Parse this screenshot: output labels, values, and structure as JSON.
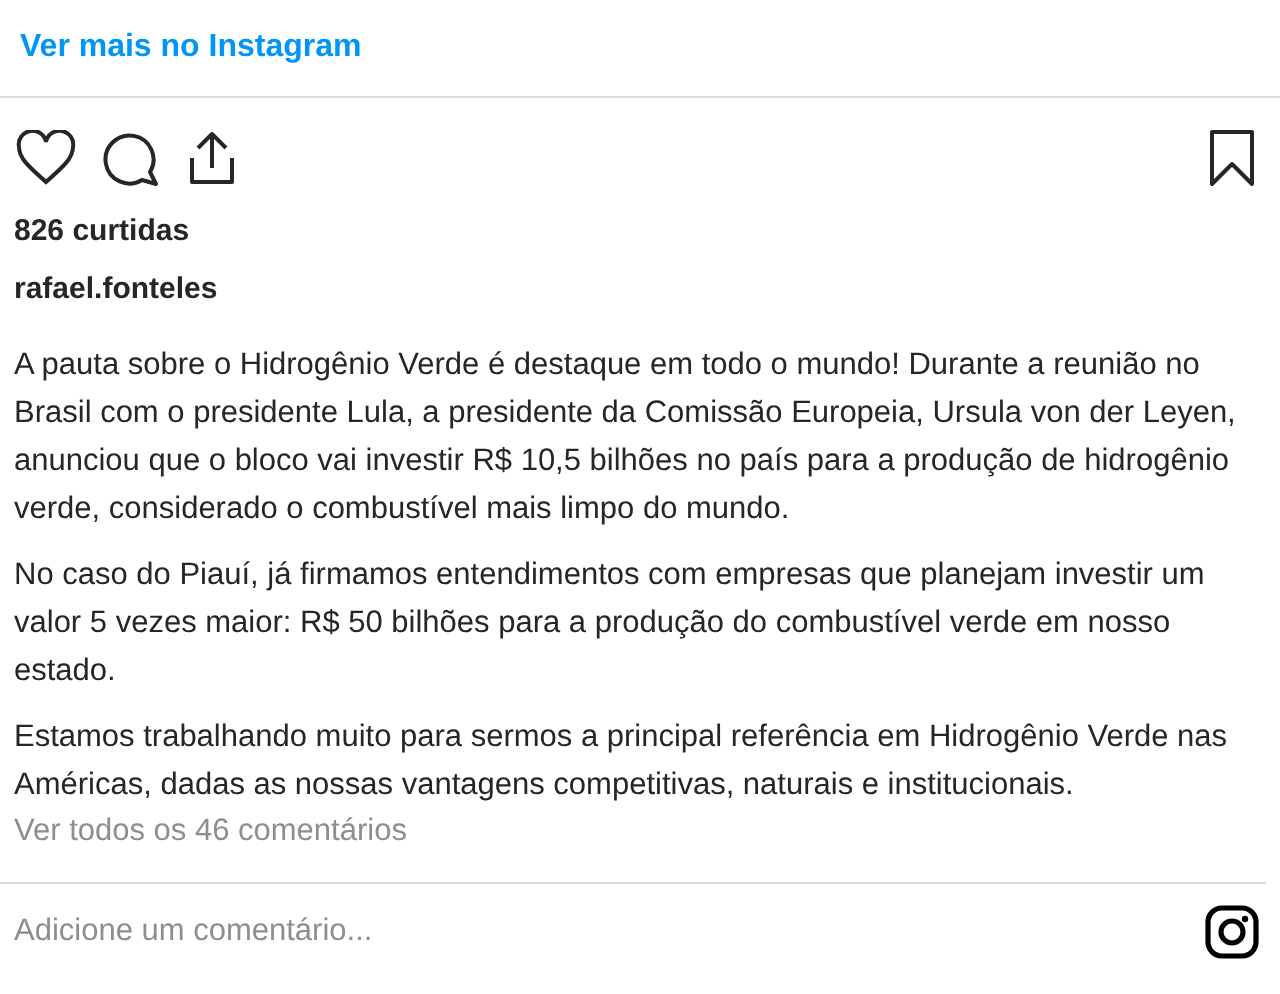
{
  "header_link": "Ver mais no Instagram",
  "likes": "826 curtidas",
  "username": "rafael.fonteles",
  "caption": [
    "A pauta sobre o Hidrogênio Verde é destaque em todo o mundo! Durante a reunião no Brasil com o presidente Lula, a presidente da Comissão Europeia, Ursula von der Leyen, anunciou que o bloco vai investir R$ 10,5 bilhões no país para a produção de hidrogênio verde, considerado o combustível mais limpo do mundo.",
    "No caso do Piauí, já firmamos entendimentos com empresas que planejam investir um valor 5 vezes maior: R$ 50 bilhões para a produção do combustível verde em nosso estado.",
    "Estamos trabalhando muito para sermos a principal referência em Hidrogênio Verde nas Américas, dadas as nossas vantagens competitivas, naturais e institucionais."
  ],
  "comments_link": "Ver todos os 46 comentários",
  "comment_field": {
    "placeholder": "Adicione um comentário..."
  }
}
